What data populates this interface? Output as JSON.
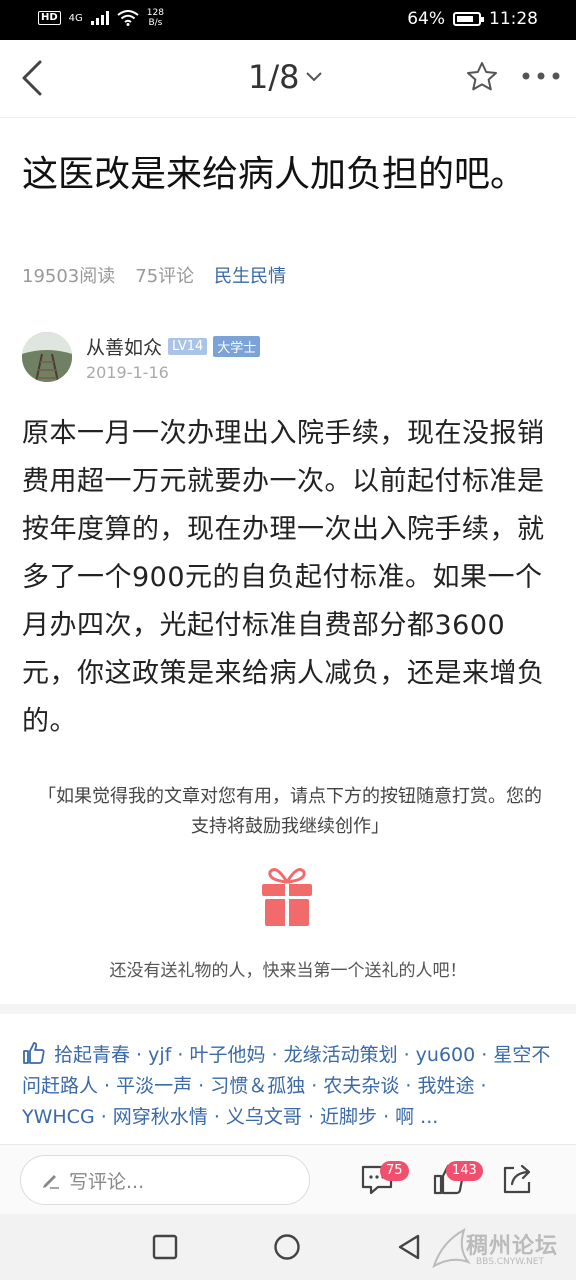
{
  "status_bar": {
    "hd": "HD",
    "signal": "4G",
    "speed_value": "128",
    "speed_unit": "B/s",
    "battery": "64%",
    "time": "11:28"
  },
  "nav": {
    "pager": "1/8"
  },
  "article": {
    "title": "这医改是来给病人加负担的吧。",
    "reads": "19503阅读",
    "comments": "75评论",
    "category": "民生民情",
    "author": "从善如众",
    "level": "LV14",
    "rank": "大学士",
    "date": "2019-1-16",
    "body": "原本一月一次办理出入院手续，现在没报销费用超一万元就要办一次。以前起付标准是按年度算的，现在办理一次出入院手续，就多了一个900元的自负起付标准。如果一个月办四次，光起付标准自费部分都3600元，你这政策是来给病人减负，还是来增负的。"
  },
  "reward": {
    "text": "「如果觉得我的文章对您有用，请点下方的按钮随意打赏。您的支持将鼓励我继续创作」",
    "hint": "还没有送礼物的人，快来当第一个送礼的人吧！"
  },
  "likes": {
    "text": "拾起青春 · yjf · 叶子他妈 · 龙缘活动策划 · yu600 · 星空不问赶路人 · 平淡一声 · 习惯＆孤独 · 农夫杂谈 · 我姓途 · YWHCG · 网穿秋水情 · 义乌文哥 · 近脚步 · 啊 ..."
  },
  "comment_bar": {
    "placeholder": "写评论...",
    "comment_count": "75",
    "like_count": "143"
  },
  "watermark": {
    "name": "稠州论坛",
    "url": "BBS.CNYW.NET"
  },
  "colors": {
    "link": "#3a6aa8",
    "badge_red": "#f0506e",
    "gift_red": "#f26b6b"
  }
}
